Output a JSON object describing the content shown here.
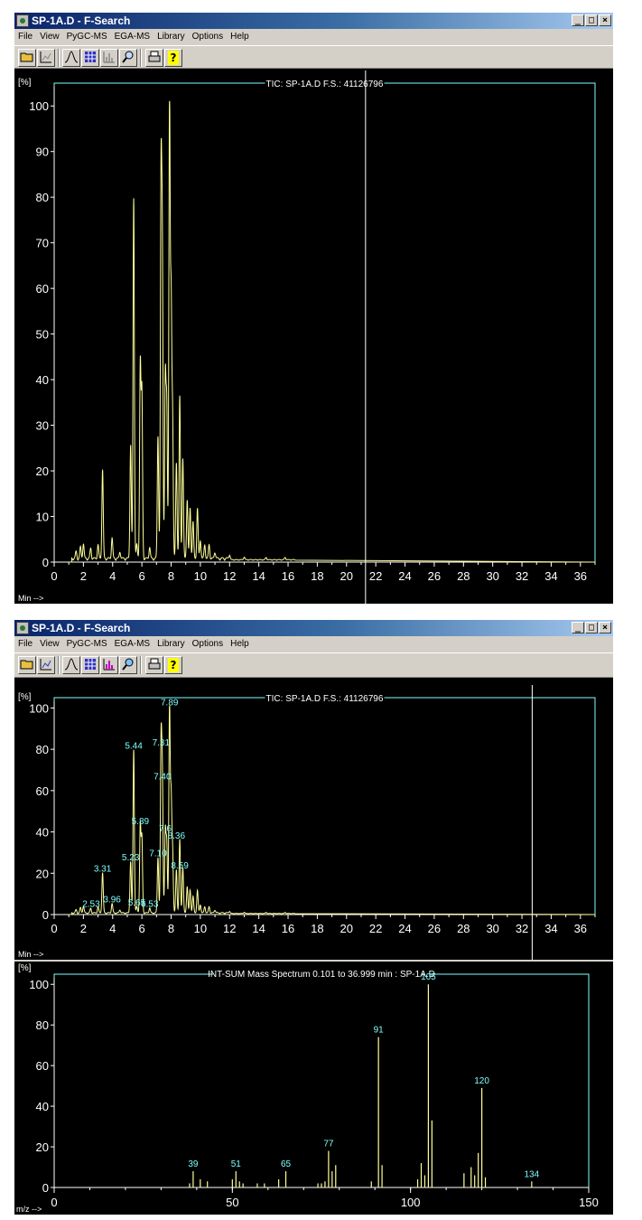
{
  "windows": [
    {
      "title": "SP-1A.D - F-Search",
      "menu": [
        "File",
        "View",
        "PyGC-MS",
        "EGA-MS",
        "Library",
        "Options",
        "Help"
      ],
      "chart_header": "TIC: SP-1A.D   F.S.: 41126796",
      "y_unit": "[%]",
      "x_unit": "Min -->"
    },
    {
      "title": "SP-1A.D - F-Search",
      "menu": [
        "File",
        "View",
        "PyGC-MS",
        "EGA-MS",
        "Library",
        "Options",
        "Help"
      ],
      "chart_header": "TIC: SP-1A.D   F.S.: 41126796",
      "y_unit": "[%]",
      "x_unit": "Min -->",
      "spectrum_header": "INT-SUM Mass Spectrum 0.101 to 36.999 min : SP-1A.D",
      "spectrum_y_unit": "[%]",
      "spectrum_x_unit": "m/z -->"
    }
  ],
  "window_buttons": [
    "_",
    "□",
    "×"
  ],
  "toolbar_icons": [
    "open-folder-icon",
    "chart-icon",
    "peak-icon",
    "table-icon",
    "bar-chart-icon",
    "search-icon",
    "print-icon",
    "help-icon"
  ],
  "colors": {
    "trace": "#ffff99",
    "peak_label": "#80ffff",
    "axis": "#ffffff",
    "frame": "#80ffff",
    "cursor": "#ffffff"
  },
  "chart_data": [
    {
      "type": "line",
      "title": "TIC: SP-1A.D   F.S.: 41126796",
      "xlabel": "Min -->",
      "ylabel": "[%]",
      "xlim": [
        0,
        37
      ],
      "ylim": [
        0,
        105
      ],
      "x_ticks": [
        0,
        2,
        4,
        6,
        8,
        10,
        12,
        14,
        16,
        18,
        20,
        22,
        24,
        26,
        28,
        30,
        32,
        34,
        36
      ],
      "y_ticks": [
        0,
        10,
        20,
        30,
        40,
        50,
        60,
        70,
        80,
        90,
        100
      ],
      "cursor_x": 21.3,
      "peaks": [
        {
          "rt": 1.5,
          "pct": 1.5
        },
        {
          "rt": 1.8,
          "pct": 2.5
        },
        {
          "rt": 2.0,
          "pct": 3.2
        },
        {
          "rt": 2.5,
          "pct": 2.2
        },
        {
          "rt": 3.0,
          "pct": 3.0
        },
        {
          "rt": 3.31,
          "pct": 19.5
        },
        {
          "rt": 3.96,
          "pct": 4.5
        },
        {
          "rt": 4.5,
          "pct": 1.5
        },
        {
          "rt": 5.23,
          "pct": 25
        },
        {
          "rt": 5.44,
          "pct": 79
        },
        {
          "rt": 5.65,
          "pct": 3
        },
        {
          "rt": 5.89,
          "pct": 42.5
        },
        {
          "rt": 6.0,
          "pct": 36
        },
        {
          "rt": 6.53,
          "pct": 2.5
        },
        {
          "rt": 7.1,
          "pct": 27
        },
        {
          "rt": 7.31,
          "pct": 80.5
        },
        {
          "rt": 7.4,
          "pct": 64
        },
        {
          "rt": 7.6,
          "pct": 39
        },
        {
          "rt": 7.7,
          "pct": 33
        },
        {
          "rt": 7.89,
          "pct": 100
        },
        {
          "rt": 8.0,
          "pct": 54
        },
        {
          "rt": 8.1,
          "pct": 30
        },
        {
          "rt": 8.36,
          "pct": 21
        },
        {
          "rt": 8.59,
          "pct": 35.5
        },
        {
          "rt": 8.8,
          "pct": 22
        },
        {
          "rt": 9.1,
          "pct": 13
        },
        {
          "rt": 9.3,
          "pct": 11
        },
        {
          "rt": 9.5,
          "pct": 8
        },
        {
          "rt": 9.8,
          "pct": 11
        },
        {
          "rt": 10.0,
          "pct": 4
        },
        {
          "rt": 10.3,
          "pct": 3
        },
        {
          "rt": 10.6,
          "pct": 3
        },
        {
          "rt": 11.0,
          "pct": 1.5
        },
        {
          "rt": 12.0,
          "pct": 1
        },
        {
          "rt": 13.0,
          "pct": 0.6
        },
        {
          "rt": 14.5,
          "pct": 0.5
        },
        {
          "rt": 15.8,
          "pct": 0.5
        }
      ]
    },
    {
      "type": "line",
      "title": "TIC: SP-1A.D   F.S.: 41126796",
      "xlabel": "Min -->",
      "ylabel": "[%]",
      "xlim": [
        0,
        37
      ],
      "ylim": [
        0,
        105
      ],
      "x_ticks": [
        0,
        2,
        4,
        6,
        8,
        10,
        12,
        14,
        16,
        18,
        20,
        22,
        24,
        26,
        28,
        30,
        32,
        34,
        36
      ],
      "y_ticks": [
        0,
        20,
        40,
        60,
        80,
        100
      ],
      "cursor_x": 32.7,
      "peak_labels": [
        {
          "rt": 7.89,
          "label": "7.89",
          "pct": 100
        },
        {
          "rt": 5.44,
          "label": "5.44",
          "pct": 79
        },
        {
          "rt": 7.31,
          "label": "7.31",
          "pct": 80.5
        },
        {
          "rt": 7.4,
          "label": "7.40",
          "pct": 64
        },
        {
          "rt": 5.89,
          "label": "5.89",
          "pct": 42.5
        },
        {
          "rt": 7.6,
          "label": "7.6",
          "pct": 39
        },
        {
          "rt": 7.1,
          "label": "7.10",
          "pct": 27
        },
        {
          "rt": 8.36,
          "label": "8.36",
          "pct": 35.5
        },
        {
          "rt": 8.59,
          "label": "8.59",
          "pct": 21
        },
        {
          "rt": 3.31,
          "label": "3.31",
          "pct": 19.5
        },
        {
          "rt": 5.23,
          "label": "5.23",
          "pct": 25
        },
        {
          "rt": 2.53,
          "label": "2.53",
          "pct": 2.5
        },
        {
          "rt": 3.96,
          "label": "3.96",
          "pct": 4.5
        },
        {
          "rt": 5.65,
          "label": "5.65",
          "pct": 3
        },
        {
          "rt": 6.53,
          "label": "6.53",
          "pct": 2.5
        }
      ]
    },
    {
      "type": "bar",
      "title": "INT-SUM Mass Spectrum 0.101 to 36.999 min : SP-1A.D",
      "xlabel": "m/z -->",
      "ylabel": "[%]",
      "xlim": [
        0,
        150
      ],
      "ylim": [
        0,
        105
      ],
      "x_ticks": [
        0,
        50,
        100,
        150
      ],
      "y_ticks": [
        0,
        20,
        40,
        60,
        80,
        100
      ],
      "lines": [
        {
          "mz": 38,
          "pct": 2
        },
        {
          "mz": 39,
          "pct": 8
        },
        {
          "mz": 41,
          "pct": 4
        },
        {
          "mz": 43,
          "pct": 3
        },
        {
          "mz": 50,
          "pct": 4
        },
        {
          "mz": 51,
          "pct": 8
        },
        {
          "mz": 52,
          "pct": 3
        },
        {
          "mz": 53,
          "pct": 2
        },
        {
          "mz": 57,
          "pct": 2
        },
        {
          "mz": 59,
          "pct": 2
        },
        {
          "mz": 63,
          "pct": 4
        },
        {
          "mz": 65,
          "pct": 8
        },
        {
          "mz": 74,
          "pct": 2
        },
        {
          "mz": 75,
          "pct": 2
        },
        {
          "mz": 76,
          "pct": 3
        },
        {
          "mz": 77,
          "pct": 18
        },
        {
          "mz": 78,
          "pct": 8
        },
        {
          "mz": 79,
          "pct": 11
        },
        {
          "mz": 89,
          "pct": 3
        },
        {
          "mz": 91,
          "pct": 74
        },
        {
          "mz": 92,
          "pct": 11
        },
        {
          "mz": 102,
          "pct": 4
        },
        {
          "mz": 103,
          "pct": 12
        },
        {
          "mz": 104,
          "pct": 6
        },
        {
          "mz": 105,
          "pct": 100
        },
        {
          "mz": 106,
          "pct": 33
        },
        {
          "mz": 115,
          "pct": 7
        },
        {
          "mz": 117,
          "pct": 10
        },
        {
          "mz": 118,
          "pct": 6
        },
        {
          "mz": 119,
          "pct": 17
        },
        {
          "mz": 120,
          "pct": 49
        },
        {
          "mz": 121,
          "pct": 5
        },
        {
          "mz": 134,
          "pct": 3
        }
      ],
      "labels": [
        {
          "mz": 39,
          "label": "39",
          "pct": 8
        },
        {
          "mz": 51,
          "label": "51",
          "pct": 8
        },
        {
          "mz": 65,
          "label": "65",
          "pct": 8
        },
        {
          "mz": 77,
          "label": "77",
          "pct": 18
        },
        {
          "mz": 91,
          "label": "91",
          "pct": 74
        },
        {
          "mz": 105,
          "label": "105",
          "pct": 100
        },
        {
          "mz": 120,
          "label": "120",
          "pct": 49
        },
        {
          "mz": 134,
          "label": "134",
          "pct": 3
        }
      ]
    }
  ]
}
